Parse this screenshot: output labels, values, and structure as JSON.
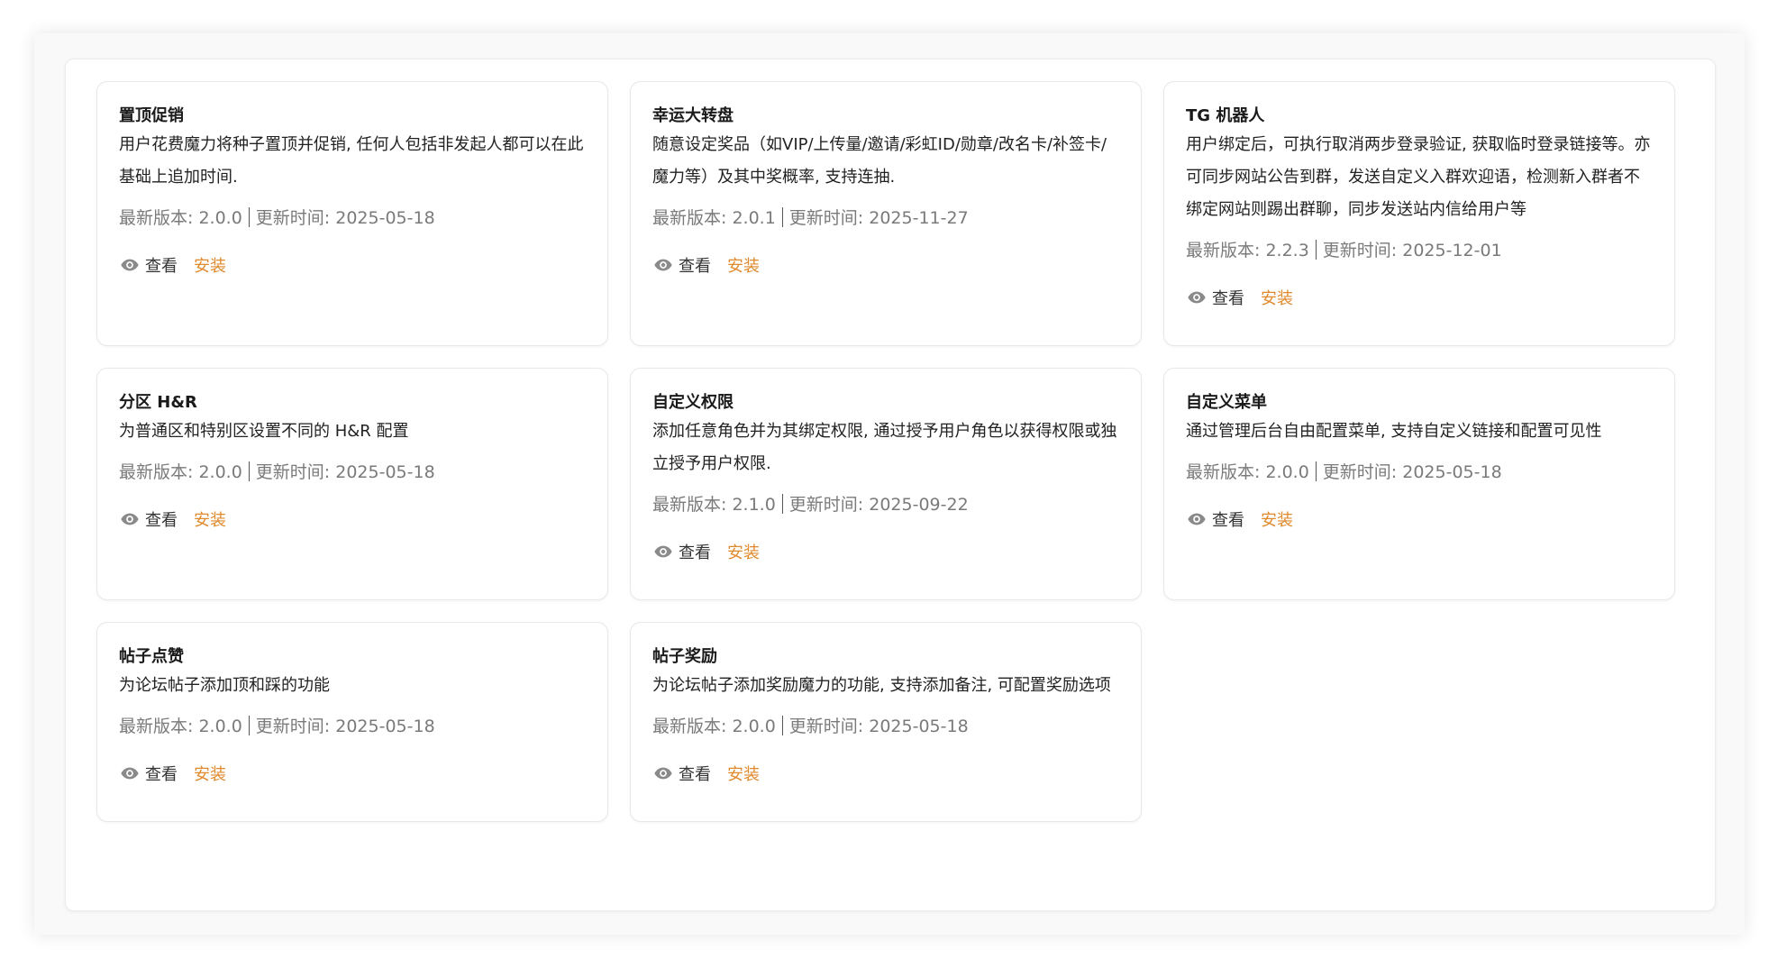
{
  "plugins": [
    {
      "title": "置顶促销",
      "description": "用户花费魔力将种子置顶并促销, 任何人包括非发起人都可以在此基础上追加时间.",
      "version_label": "最新版本: 2.0.0",
      "updated_label": "更新时间: 2025-05-18",
      "view_label": "查看",
      "install_label": "安装"
    },
    {
      "title": "幸运大转盘",
      "description": "随意设定奖品（如VIP/上传量/邀请/彩虹ID/勋章/改名卡/补签卡/魔力等）及其中奖概率, 支持连抽.",
      "version_label": "最新版本: 2.0.1",
      "updated_label": "更新时间: 2025-11-27",
      "view_label": "查看",
      "install_label": "安装"
    },
    {
      "title": "TG 机器人",
      "description": "用户绑定后，可执行取消两步登录验证, 获取临时登录链接等。亦可同步网站公告到群，发送自定义入群欢迎语，检测新入群者不绑定网站则踢出群聊，同步发送站内信给用户等",
      "version_label": "最新版本: 2.2.3",
      "updated_label": "更新时间: 2025-12-01",
      "view_label": "查看",
      "install_label": "安装"
    },
    {
      "title": "分区 H&R",
      "description": "为普通区和特别区设置不同的 H&R 配置",
      "version_label": "最新版本: 2.0.0",
      "updated_label": "更新时间: 2025-05-18",
      "view_label": "查看",
      "install_label": "安装"
    },
    {
      "title": "自定义权限",
      "description": "添加任意角色并为其绑定权限, 通过授予用户角色以获得权限或独立授予用户权限.",
      "version_label": "最新版本: 2.1.0",
      "updated_label": "更新时间: 2025-09-22",
      "view_label": "查看",
      "install_label": "安装"
    },
    {
      "title": "自定义菜单",
      "description": "通过管理后台自由配置菜单, 支持自定义链接和配置可见性",
      "version_label": "最新版本: 2.0.0",
      "updated_label": "更新时间: 2025-05-18",
      "view_label": "查看",
      "install_label": "安装"
    },
    {
      "title": "帖子点赞",
      "description": "为论坛帖子添加顶和踩的功能",
      "version_label": "最新版本: 2.0.0",
      "updated_label": "更新时间: 2025-05-18",
      "view_label": "查看",
      "install_label": "安装"
    },
    {
      "title": "帖子奖励",
      "description": "为论坛帖子添加奖励魔力的功能, 支持添加备注, 可配置奖励选项",
      "version_label": "最新版本: 2.0.0",
      "updated_label": "更新时间: 2025-05-18",
      "view_label": "查看",
      "install_label": "安装"
    }
  ],
  "icons": {
    "view": "eye-icon"
  },
  "colors": {
    "install": "#e08a2e",
    "meta": "#7a7a7a",
    "icon": "#8a8a8a"
  }
}
